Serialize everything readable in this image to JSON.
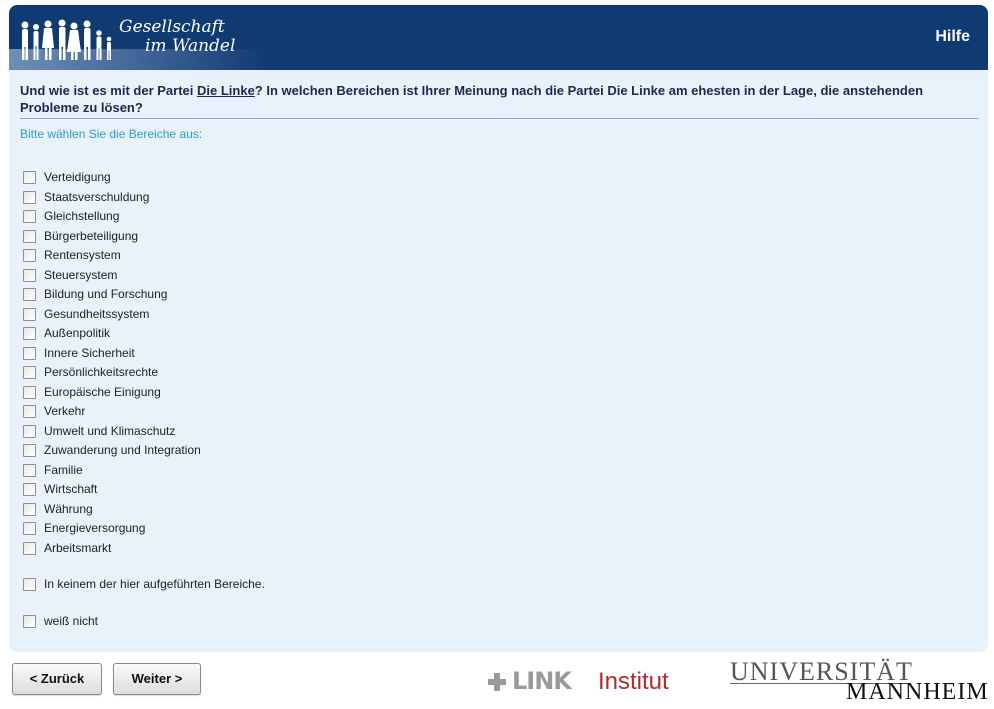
{
  "header": {
    "logo_line1": "Gesellschaft",
    "logo_line2": "im Wandel",
    "help_label": "Hilfe"
  },
  "question": {
    "prefix": "Und wie ist es mit der Partei ",
    "party_link": "Die Linke",
    "suffix": "? In welchen Bereichen ist Ihrer Meinung nach die Partei Die Linke am ehesten in der Lage, die anstehenden Probleme zu lösen?"
  },
  "instruction": "Bitte wählen Sie die Bereiche aus:",
  "options": [
    "Verteidigung",
    "Staatsverschuldung",
    "Gleichstellung",
    "Bürgerbeteiligung",
    "Rentensystem",
    "Steuersystem",
    "Bildung und Forschung",
    "Gesundheitssystem",
    "Außenpolitik",
    "Innere Sicherheit",
    "Persönlichkeitsrechte",
    "Europäische Einigung",
    "Verkehr",
    "Umwelt und Klimaschutz",
    "Zuwanderung und Integration",
    "Familie",
    "Wirtschaft",
    "Währung",
    "Energieversorgung",
    "Arbeitsmarkt"
  ],
  "none_option": "In keinem der hier aufgeführten Bereiche.",
  "dont_know_option": "weiß nicht",
  "nav": {
    "back_label": "< Zurück",
    "next_label": "Weiter >"
  },
  "logos": {
    "link_word": "LINK",
    "link_institut": "Institut",
    "uni_line1": "UNIVERSITÄT",
    "uni_line2": "MANNHEIM"
  },
  "colors": {
    "header_bg": "#103a72",
    "panel_bg": "#e9f1fa",
    "instruction_text": "#2aa0c8",
    "link_red": "#b22a2a"
  }
}
